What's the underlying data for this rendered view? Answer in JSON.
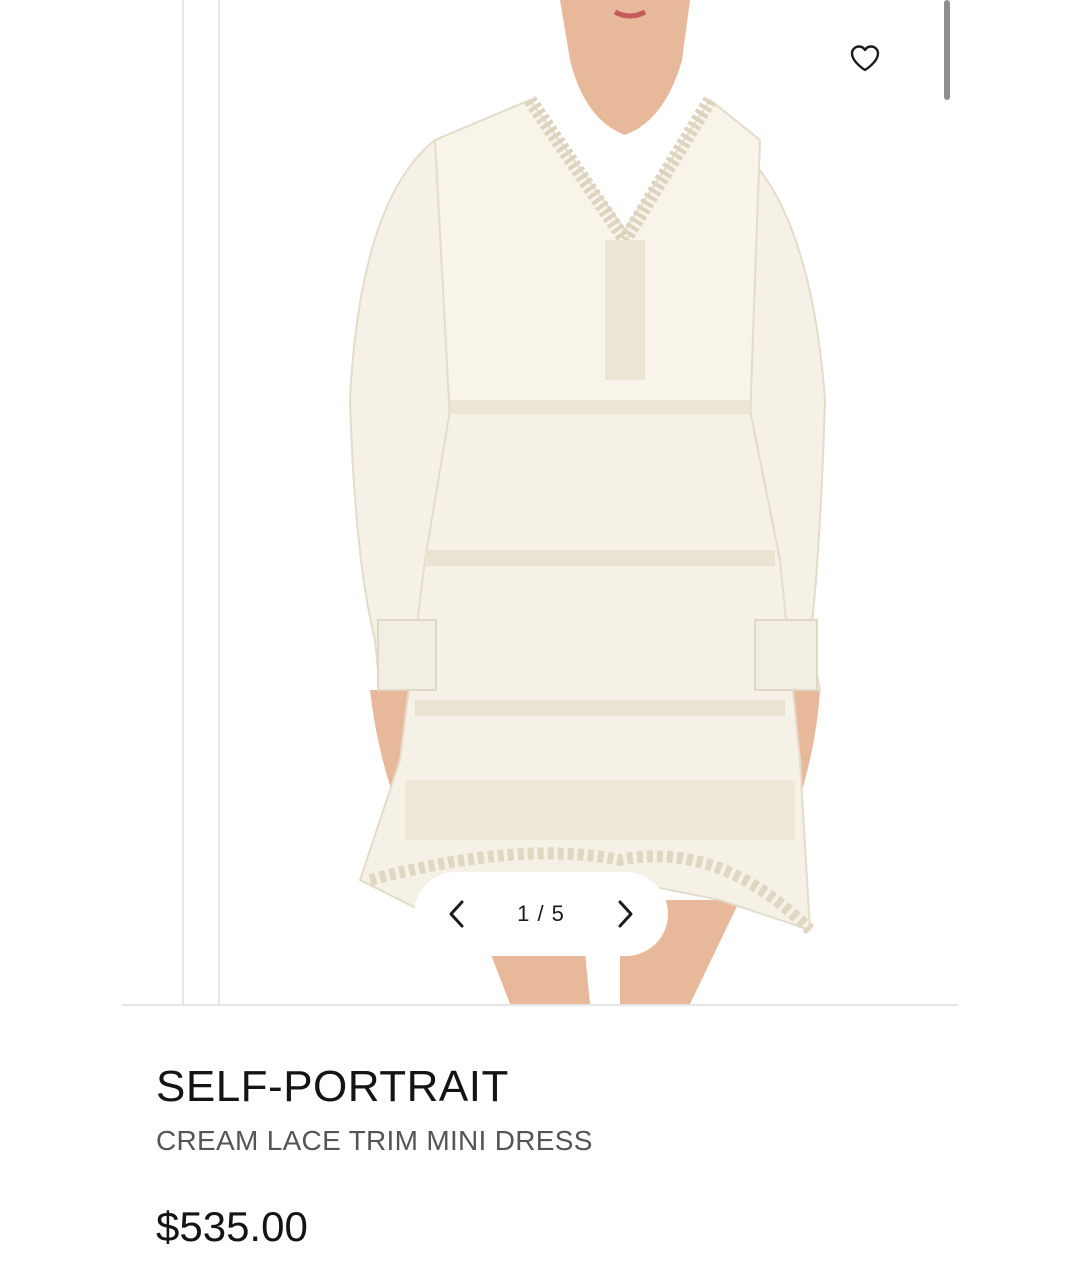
{
  "gallery": {
    "current": "1",
    "total": "5",
    "counter": "1 / 5",
    "prev_icon": "chevron-left-icon",
    "next_icon": "chevron-right-icon",
    "wishlist_icon": "heart-outline-icon",
    "image_alt": "Model wearing cream lace trim mini dress"
  },
  "product": {
    "brand": "SELF-PORTRAIT",
    "name": "CREAM LACE TRIM MINI DRESS",
    "price": "$535.00"
  },
  "colors": {
    "dress": "#f6f1e6",
    "lace": "#e9e2d2",
    "skin": "#e8b89b",
    "text": "#141414",
    "muted": "#555555"
  }
}
